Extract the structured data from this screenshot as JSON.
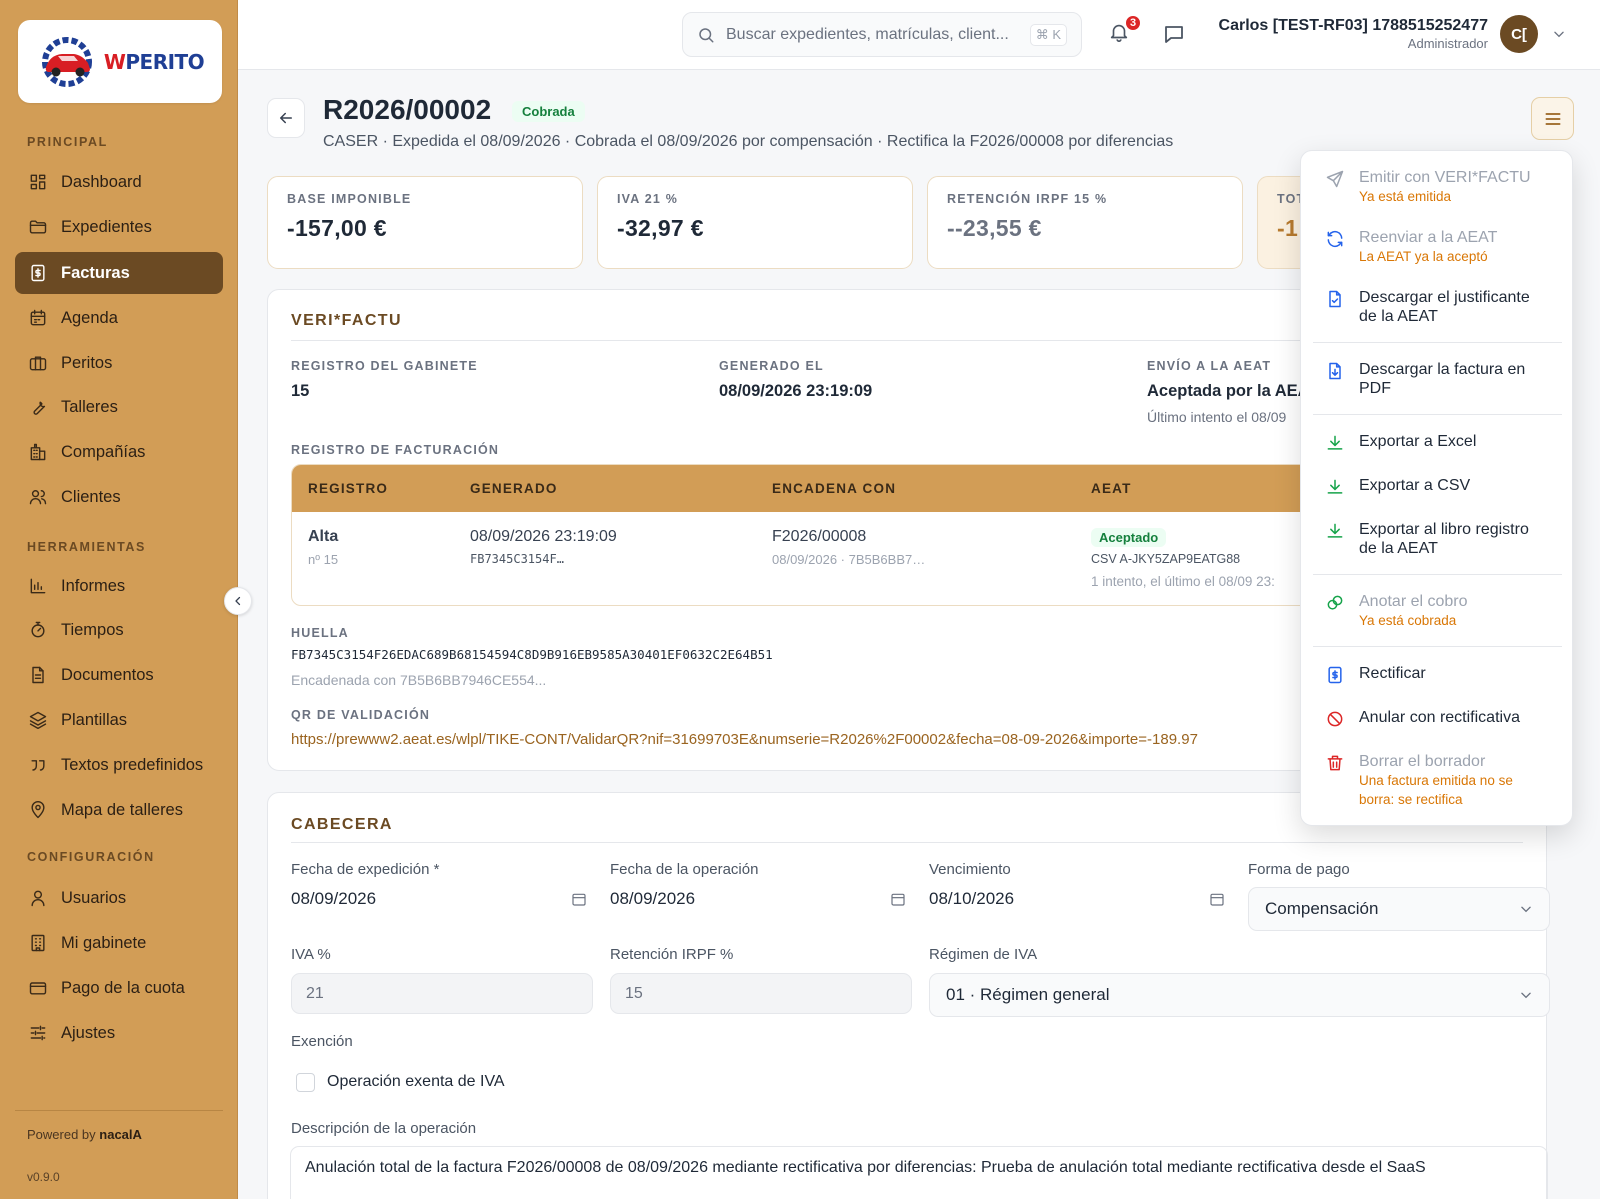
{
  "brand": {
    "logo_text_red": "W",
    "logo_text_blue": "PERITO"
  },
  "sidebar": {
    "sections": [
      {
        "label": "PRINCIPAL",
        "items": [
          {
            "label": "Dashboard",
            "icon": "grid-icon"
          },
          {
            "label": "Expedientes",
            "icon": "folder-icon"
          },
          {
            "label": "Facturas",
            "icon": "invoice-icon",
            "active": true
          },
          {
            "label": "Agenda",
            "icon": "calendar-icon"
          },
          {
            "label": "Peritos",
            "icon": "briefcase-icon"
          },
          {
            "label": "Talleres",
            "icon": "wrench-icon"
          },
          {
            "label": "Compañías",
            "icon": "building-icon"
          },
          {
            "label": "Clientes",
            "icon": "users-icon"
          }
        ]
      },
      {
        "label": "HERRAMIENTAS",
        "items": [
          {
            "label": "Informes",
            "icon": "bar-chart-icon"
          },
          {
            "label": "Tiempos",
            "icon": "stopwatch-icon"
          },
          {
            "label": "Documentos",
            "icon": "document-icon"
          },
          {
            "label": "Plantillas",
            "icon": "layers-icon"
          },
          {
            "label": "Textos predefinidos",
            "icon": "quote-icon"
          },
          {
            "label": "Mapa de talleres",
            "icon": "map-pin-icon"
          }
        ]
      },
      {
        "label": "CONFIGURACIÓN",
        "items": [
          {
            "label": "Usuarios",
            "icon": "user-icon"
          },
          {
            "label": "Mi gabinete",
            "icon": "office-icon"
          },
          {
            "label": "Pago de la cuota",
            "icon": "credit-card-icon"
          },
          {
            "label": "Ajustes",
            "icon": "sliders-icon"
          }
        ]
      }
    ],
    "powered_by": "Powered by",
    "powered_brand": "nacalA",
    "version": "v0.9.0"
  },
  "topbar": {
    "search_placeholder": "Buscar expedientes, matrículas, client...",
    "search_shortcut": "⌘ K",
    "notifications_count": "3",
    "user_name": "Carlos [TEST-RF03] 1788515252477",
    "user_role": "Administrador",
    "avatar_initials": "C["
  },
  "invoice": {
    "number": "R2026/00002",
    "status": "Cobrada",
    "subtitle": "CASER · Expedida el 08/09/2026 · Cobrada el 08/09/2026 por compensación · Rectifica la F2026/00008 por diferencias"
  },
  "kpis": [
    {
      "label": "BASE IMPONIBLE",
      "value": "-157,00 €"
    },
    {
      "label": "IVA 21 %",
      "value": "-32,97 €"
    },
    {
      "label": "RETENCIÓN IRPF 15 %",
      "value": "--23,55 €"
    },
    {
      "label": "TOT",
      "value": "-1"
    }
  ],
  "verifactu": {
    "title": "VERI*FACTU",
    "registro_label": "REGISTRO DEL GABINETE",
    "registro_value": "15",
    "generado_label": "GENERADO EL",
    "generado_value": "08/09/2026 23:19:09",
    "envio_label": "ENVÍO A LA AEAT",
    "envio_value": "Aceptada por la AEA",
    "envio_sub": "Último intento el 08/09",
    "registro_facturacion_label": "REGISTRO DE FACTURACIÓN",
    "table": {
      "headers": [
        "REGISTRO",
        "GENERADO",
        "ENCADENA CON",
        "AEAT"
      ],
      "row": {
        "registro": "Alta",
        "registro_sub": "nº 15",
        "generado": "08/09/2026 23:19:09",
        "generado_sub": "FB7345C3154F…",
        "encadena": "F2026/00008",
        "encadena_sub": "08/09/2026 · 7B5B6BB7…",
        "aeat_status": "Aceptado",
        "aeat_csv": "CSV A-JKY5ZAP9EATG88",
        "aeat_sub": "1 intento, el último el 08/09 23:"
      }
    },
    "huella_label": "HUELLA",
    "huella_value": "FB7345C3154F26EDAC689B68154594C8D9B916EB9585A30401EF0632C2E64B51",
    "huella_sub": "Encadenada con 7B5B6BB7946CE554...",
    "qr_label": "QR DE VALIDACIÓN",
    "qr_url": "https://prewww2.aeat.es/wlpl/TIKE-CONT/ValidarQR?nif=31699703E&numserie=R2026%2F00002&fecha=08-09-2026&importe=-189.97"
  },
  "cabecera": {
    "title": "CABECERA",
    "fecha_expedicion_label": "Fecha de expedición *",
    "fecha_expedicion": "08/09/2026",
    "fecha_operacion_label": "Fecha de la operación",
    "fecha_operacion": "08/09/2026",
    "vencimiento_label": "Vencimiento",
    "vencimiento": "08/10/2026",
    "forma_pago_label": "Forma de pago",
    "forma_pago": "Compensación",
    "iva_label": "IVA %",
    "iva": "21",
    "irpf_label": "Retención IRPF %",
    "irpf": "15",
    "regimen_label": "Régimen de IVA",
    "regimen": "01 · Régimen general",
    "exencion_label": "Exención",
    "exenta_label": "Operación exenta de IVA",
    "descripcion_label": "Descripción de la operación",
    "descripcion": "Anulación total de la factura F2026/00008 de 08/09/2026 mediante rectificativa por diferencias: Prueba de anulación total mediante rectificativa desde el SaaS"
  },
  "actions_menu": [
    {
      "label": "Emitir con VERI*FACTU",
      "note": "Ya está emitida",
      "icon": "send-icon",
      "disabled": true
    },
    {
      "label": "Reenviar a la AEAT",
      "note": "La AEAT ya la aceptó",
      "icon": "refresh-icon",
      "disabled": true
    },
    {
      "label": "Descargar el justificante de la AEAT",
      "icon": "file-check-icon"
    },
    {
      "label": "Descargar la factura en PDF",
      "icon": "file-download-icon"
    },
    {
      "label": "Exportar a Excel",
      "icon": "download-icon"
    },
    {
      "label": "Exportar a CSV",
      "icon": "download-icon"
    },
    {
      "label": "Exportar al libro registro de la AEAT",
      "icon": "download-icon"
    },
    {
      "label": "Anotar el cobro",
      "note": "Ya está cobrada",
      "icon": "coins-icon",
      "disabled": true
    },
    {
      "label": "Rectificar",
      "icon": "receipt-icon"
    },
    {
      "label": "Anular con rectificativa",
      "icon": "ban-icon"
    },
    {
      "label": "Borrar el borrador",
      "note": "Una factura emitida no se borra: se rectifica",
      "icon": "trash-icon",
      "disabled": true
    }
  ],
  "colors": {
    "sidebar": "#d29d56",
    "active": "#6b4a23",
    "accent": "#9a6420",
    "success": "#15803d",
    "warning": "#d97706",
    "danger": "#dc2626",
    "icon_blue": "#2563eb",
    "icon_green": "#16a34a"
  }
}
